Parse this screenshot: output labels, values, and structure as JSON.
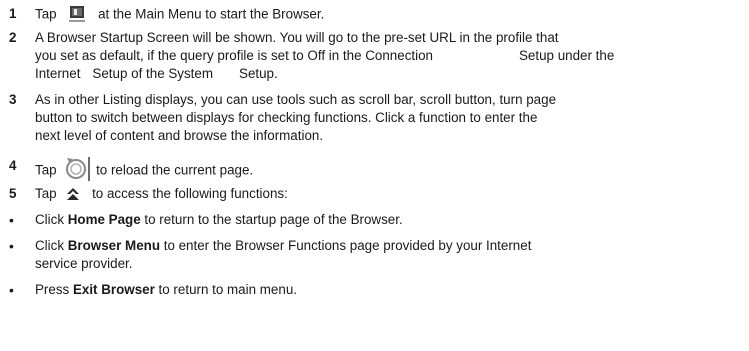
{
  "steps": [
    {
      "num": "1",
      "pre": "Tap",
      "post": "at the Main Menu to start the Browser.",
      "icon": "browser-app-icon"
    },
    {
      "num": "2",
      "lines": [
        "A Browser  Startup Screen will be shown. You will go to the pre-set URL in the profile that",
        "you set as default, if the query profile is set to Off in the Connection",
        "Setup under the",
        "Internet",
        "Setup of the System",
        "Setup."
      ]
    },
    {
      "num": "3",
      "lines": [
        "As in other Listing displays, you can use tools such as scroll bar, scroll button, turn page",
        "button to switch between displays for checking functions. Click a function to enter the",
        "next level of content and browse the information."
      ]
    },
    {
      "num": "4",
      "pre": "Tap",
      "post": "to reload the current page.",
      "icon": "reload-icon"
    },
    {
      "num": "5",
      "pre": "Tap",
      "post": "to access the following functions:",
      "icon": "menu-up-icon"
    }
  ],
  "bullets": [
    {
      "pre": "Click ",
      "bold": "Home Page",
      "post": " to return to the startup page of the Browser."
    },
    {
      "pre": "Click ",
      "bold": "Browser Menu",
      "post": "  to enter the Browser Functions page provided by your Internet",
      "cont": "service provider."
    },
    {
      "pre": "Press ",
      "bold": "Exit Browser",
      "post": "  to return to main menu."
    }
  ],
  "bullet_char": "•"
}
